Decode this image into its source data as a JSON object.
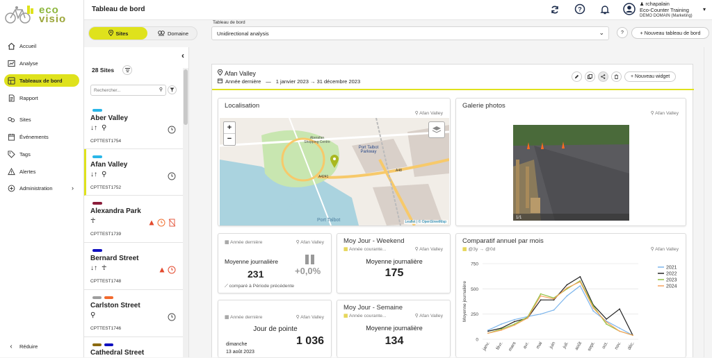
{
  "brand": {
    "line1": "eco",
    "line2": "visio",
    "accent": "#dfe21c",
    "green": "#8cb63c"
  },
  "nav": {
    "items": [
      {
        "label": "Accueil",
        "icon": "home-icon"
      },
      {
        "label": "Analyse",
        "icon": "analysis-icon"
      },
      {
        "label": "Tableaux de bord",
        "icon": "dashboard-icon",
        "active": true
      },
      {
        "label": "Rapport",
        "icon": "report-icon"
      },
      {
        "label": "Sites",
        "icon": "sites-icon"
      },
      {
        "label": "Événements",
        "icon": "calendar-icon"
      },
      {
        "label": "Tags",
        "icon": "tag-icon"
      },
      {
        "label": "Alertes",
        "icon": "alert-icon"
      },
      {
        "label": "Administration",
        "icon": "admin-icon"
      }
    ],
    "collapse": "Réduire"
  },
  "header": {
    "title": "Tableau de bord",
    "user": {
      "name": "rchapalain",
      "org": "Eco-Counter Training",
      "domain": "DEMO DOMAIN (Marketing)"
    }
  },
  "toolbar": {
    "tab_sites": "Sites",
    "tab_domain": "Domaine",
    "select_label": "Tableau de bord",
    "select_value": "Unidirectional analysis",
    "help": "?",
    "new_dashboard": "+ Nouveau tableau de bord"
  },
  "sites": {
    "count": "28 Sites",
    "search_placeholder": "Rechercher...",
    "list": [
      {
        "name": "Aber Valley",
        "code": "CPTTEST1754",
        "colors": [
          "#29b6e8"
        ],
        "modes": "↓↑ ⚲",
        "selected": false
      },
      {
        "name": "Afan Valley",
        "code": "CPTTEST1752",
        "colors": [
          "#29b6e8"
        ],
        "modes": "↓↑ ⚲",
        "selected": true
      },
      {
        "name": "Alexandra Park",
        "code": "CPTTEST1739",
        "colors": [
          "#8b1d3a"
        ],
        "modes": "☥",
        "selected": false,
        "alert": true
      },
      {
        "name": "Bernard Street",
        "code": "CPTTEST1748",
        "colors": [
          "#1010c0"
        ],
        "modes": "↓↑ ☥",
        "selected": false,
        "alert": true
      },
      {
        "name": "Carlston Street",
        "code": "CPTTEST1746",
        "colors": [
          "#9e9e9e",
          "#f26a2e"
        ],
        "modes": "⚲",
        "selected": false
      },
      {
        "name": "Cathedral Street",
        "code": "",
        "colors": [
          "#8b6a10",
          "#1010c0"
        ],
        "modes": "",
        "selected": false
      }
    ]
  },
  "dashboard": {
    "site": "Afan Valley",
    "period_label": "Année dernière",
    "period_sep": "—",
    "period_range": "1 janvier 2023 → 31 décembre 2023",
    "new_widget": "+ Nouveau widget"
  },
  "widgets": {
    "map": {
      "title": "Localisation",
      "site": "Afan Valley",
      "zoom_in": "+",
      "zoom_out": "−",
      "attribution": "Leaflet | © OpenStreetMap",
      "labels": [
        "Port Talbot Parkway",
        "A4241",
        "A48",
        "Port Talbot",
        "Aberafan Shopping Centre"
      ]
    },
    "photos": {
      "title": "Galerie photos",
      "site": "Afan Valley",
      "counter": "1/1"
    },
    "avg": {
      "period": "Année dernière",
      "site": "Afan Valley",
      "label": "Moyenne journalière",
      "value": "231",
      "delta": "+0,0%",
      "compare_prefix": "comparé à",
      "compare": "Période précédente"
    },
    "weekend": {
      "title": "Moy Jour - Weekend",
      "period": "Année courante...",
      "site": "Afan Valley",
      "label": "Moyenne journalière",
      "value": "175"
    },
    "peak": {
      "period": "Année dernière",
      "site": "Afan Valley",
      "label": "Jour de pointe",
      "day": "dimanche",
      "date": "13 août 2023",
      "value": "1 036"
    },
    "week": {
      "title": "Moy Jour - Semaine",
      "period": "Année courante...",
      "site": "Afan Valley",
      "label": "Moyenne journalière",
      "value": "134"
    },
    "compare": {
      "title": "Comparatif annuel par mois",
      "range": "@3y → @0d",
      "site": "Afan Valley"
    }
  },
  "chart_data": {
    "type": "line",
    "ylabel": "Moyenne journalière",
    "ylim": [
      0,
      750
    ],
    "yticks": [
      0,
      250,
      500,
      750
    ],
    "legend_position": "top-right",
    "categories": [
      "janv.",
      "févr.",
      "mars",
      "avr.",
      "mai",
      "juin",
      "juil.",
      "août",
      "sept.",
      "oct.",
      "nov.",
      "déc."
    ],
    "series": [
      {
        "name": "2021",
        "color": "#7cb5ec",
        "values": [
          90,
          150,
          195,
          225,
          250,
          290,
          430,
          530,
          280,
          180,
          110,
          40
        ]
      },
      {
        "name": "2022",
        "color": "#222222",
        "values": [
          80,
          110,
          175,
          210,
          390,
          390,
          540,
          620,
          340,
          200,
          300,
          40
        ]
      },
      {
        "name": "2023",
        "color": "#90c040",
        "values": [
          60,
          100,
          150,
          220,
          450,
          410,
          500,
          580,
          330,
          150,
          80,
          40
        ]
      },
      {
        "name": "2024",
        "color": "#f7a35c",
        "values": [
          60,
          90,
          140,
          210,
          430,
          400,
          510,
          570,
          310,
          170,
          80,
          40
        ]
      }
    ]
  }
}
